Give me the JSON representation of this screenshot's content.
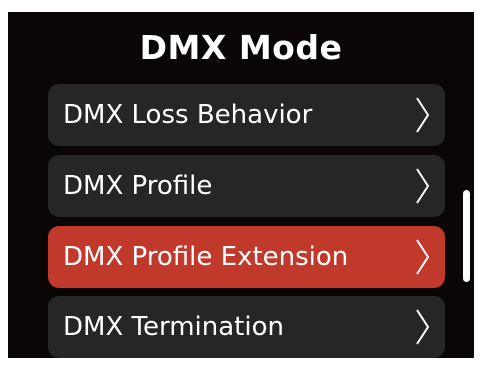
{
  "header": {
    "title": "DMX Mode"
  },
  "menu": {
    "items": [
      {
        "label": "DMX Loss Behavior",
        "icon": "chevron-right-icon",
        "selected": false
      },
      {
        "label": "DMX Profile",
        "icon": "chevron-right-icon",
        "selected": false
      },
      {
        "label": "DMX Profile Extension",
        "icon": "chevron-right-icon",
        "selected": true
      },
      {
        "label": "DMX Termination",
        "icon": "chevron-right-icon",
        "selected": false
      }
    ]
  },
  "colors": {
    "background": "#0a0606",
    "item_background": "#262626",
    "selected_background": "#c0392b",
    "text": "#ffffff"
  }
}
